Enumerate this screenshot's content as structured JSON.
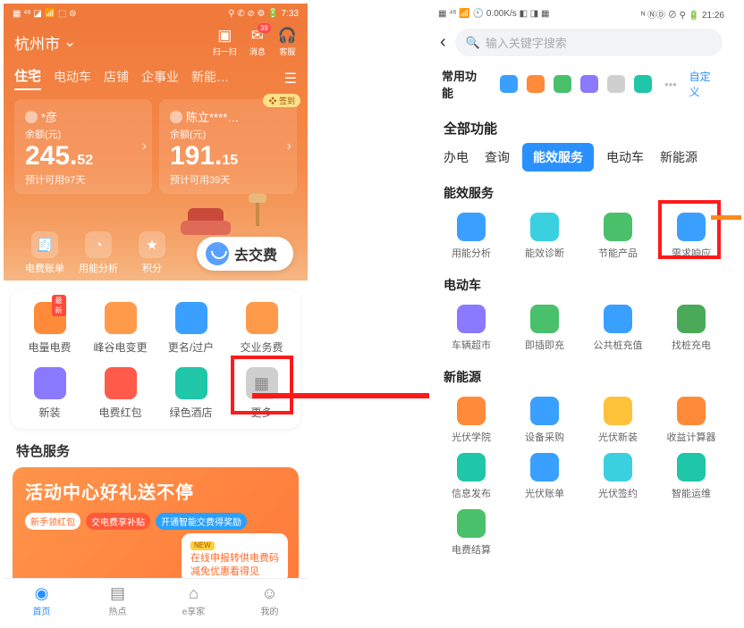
{
  "left": {
    "status": {
      "left": "▦ ⁴⁶ ◪ 📶 ⬚ ⊜",
      "right": "⚲ ✆ ⊘ ⚙ 🔋 7:33"
    },
    "location": "杭州市",
    "top_icons": [
      {
        "name": "scan",
        "label": "扫一扫"
      },
      {
        "name": "msg",
        "label": "消息",
        "badge": "39"
      },
      {
        "name": "cs",
        "label": "客服"
      }
    ],
    "tabs": [
      "住宅",
      "电动车",
      "店铺",
      "企事业",
      "新能…"
    ],
    "accounts": [
      {
        "name": "*彦",
        "bal_label": "余额(元)",
        "int": "245.",
        "dec": "52",
        "est": "预计可用97天"
      },
      {
        "name": "陈立****…",
        "bal_label": "余额(元)",
        "int": "191.",
        "dec": "15",
        "est": "预计可用39天",
        "badge": "❖ 签到"
      }
    ],
    "quick": [
      {
        "name": "bill",
        "label": "电费账单"
      },
      {
        "name": "usage",
        "label": "用能分析"
      },
      {
        "name": "points",
        "label": "积分"
      }
    ],
    "pay_pill": "去交费",
    "funcs": [
      {
        "name": "dl",
        "label": "电量电费",
        "color": "c-orn",
        "tag": "最新"
      },
      {
        "name": "fg",
        "label": "峰谷电变更",
        "color": "c-orn2"
      },
      {
        "name": "gm",
        "label": "更名/过户",
        "color": "c-blue"
      },
      {
        "name": "jy",
        "label": "交业务费",
        "color": "c-orn2"
      },
      {
        "name": "xz",
        "label": "新装",
        "color": "c-purple"
      },
      {
        "name": "hb",
        "label": "电费红包",
        "color": "c-red"
      },
      {
        "name": "ls",
        "label": "绿色酒店",
        "color": "c-teal"
      },
      {
        "name": "more",
        "label": "更多",
        "color": "c-gray"
      }
    ],
    "special_title": "特色服务",
    "promo": {
      "headline": "活动中心好礼送不停",
      "chips": [
        "新手领红包",
        "交电费享补贴",
        "开通智能交费得奖励"
      ],
      "new": "NEW",
      "line1": "在线申报转供电费码",
      "line2": "减免优惠看得见"
    },
    "bottom_nav": [
      {
        "name": "home",
        "label": "首页",
        "active": true
      },
      {
        "name": "hot",
        "label": "热点"
      },
      {
        "name": "ehome",
        "label": "e享家"
      },
      {
        "name": "me",
        "label": "我的"
      }
    ]
  },
  "right": {
    "status": {
      "left": "▦ ⁴⁶ 📶 🕙 0.00K/s ◧ ◨ ▦",
      "right": "ᴺ ⓃⒹ ⊘ ⚲ 🔋 21:26"
    },
    "search_placeholder": "输入关键字搜索",
    "common_label": "常用功能",
    "custom_label": "自定义",
    "common_icons": [
      "c-blue",
      "c-orn",
      "c-green",
      "c-purple",
      "c-gray",
      "c-teal"
    ],
    "all_label": "全部功能",
    "tabs": [
      "办电",
      "查询",
      "能效服务",
      "电动车",
      "新能源"
    ],
    "active_tab": 2,
    "sections": [
      {
        "title": "能效服务",
        "items": [
          {
            "name": "yn",
            "label": "用能分析",
            "color": "c-blue"
          },
          {
            "name": "zd",
            "label": "能效诊断",
            "color": "c-cyan"
          },
          {
            "name": "jn",
            "label": "节能产品",
            "color": "c-green"
          },
          {
            "name": "xq",
            "label": "需求响应",
            "color": "c-blue"
          }
        ]
      },
      {
        "title": "电动车",
        "items": [
          {
            "name": "cs",
            "label": "车辆超市",
            "color": "c-purple"
          },
          {
            "name": "jc",
            "label": "即插即充",
            "color": "c-green"
          },
          {
            "name": "gz",
            "label": "公共桩充值",
            "color": "c-blue"
          },
          {
            "name": "zz",
            "label": "找桩充电",
            "color": "c-dgreen"
          }
        ]
      },
      {
        "title": "新能源",
        "items": [
          {
            "name": "xy",
            "label": "光伏学院",
            "color": "c-orn"
          },
          {
            "name": "sb",
            "label": "设备采购",
            "color": "c-blue"
          },
          {
            "name": "gx",
            "label": "光伏新装",
            "color": "c-yel"
          },
          {
            "name": "sy",
            "label": "收益计算器",
            "color": "c-orn"
          },
          {
            "name": "xf",
            "label": "信息发布",
            "color": "c-teal"
          },
          {
            "name": "gz2",
            "label": "光伏账单",
            "color": "c-blue"
          },
          {
            "name": "qy",
            "label": "光伏签约",
            "color": "c-cyan"
          },
          {
            "name": "zn",
            "label": "智能运维",
            "color": "c-teal"
          },
          {
            "name": "df",
            "label": "电费结算",
            "color": "c-green"
          }
        ]
      }
    ]
  }
}
